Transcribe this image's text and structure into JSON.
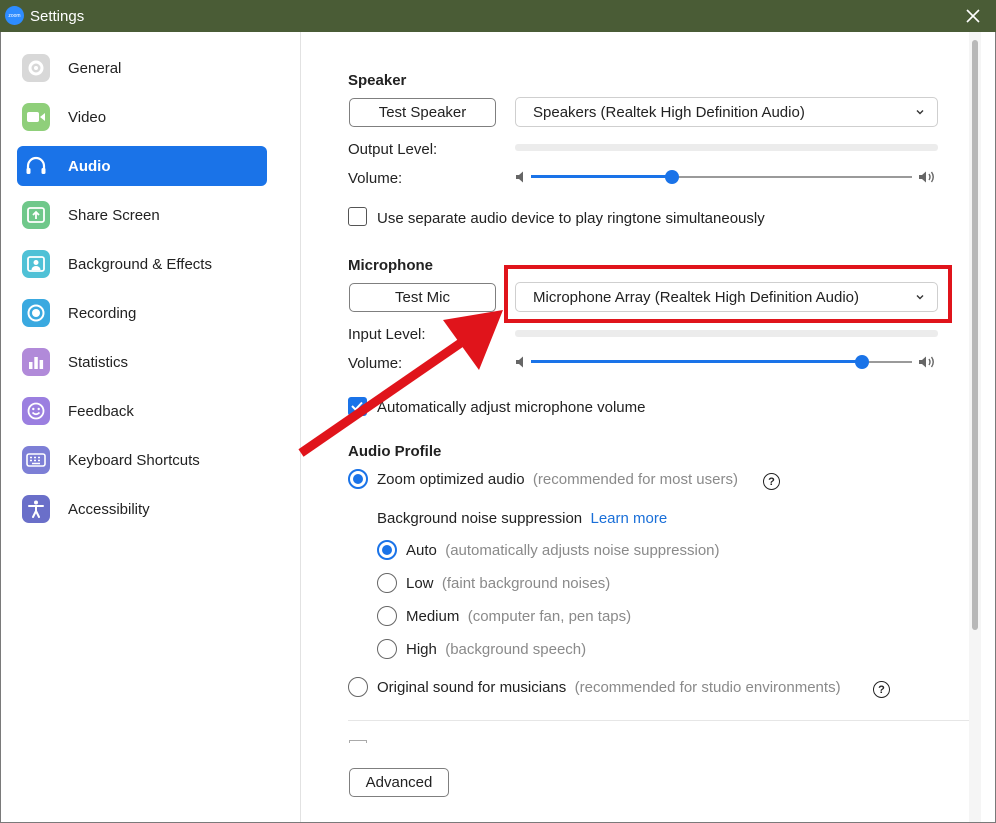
{
  "window": {
    "title": "Settings",
    "logo_text": "zoom"
  },
  "sidebar": {
    "items": [
      {
        "label": "General",
        "icon": "gear-icon",
        "color": "#cfcfcf",
        "active": false
      },
      {
        "label": "Video",
        "icon": "video-camera-icon",
        "color": "#8fcf7a",
        "active": false
      },
      {
        "label": "Audio",
        "icon": "headphones-icon",
        "color": "#1a73e8",
        "active": true
      },
      {
        "label": "Share Screen",
        "icon": "share-screen-icon",
        "color": "#6fc88a",
        "active": false
      },
      {
        "label": "Background & Effects",
        "icon": "background-person-icon",
        "color": "#4fc1d6",
        "active": false
      },
      {
        "label": "Recording",
        "icon": "recording-icon",
        "color": "#3aa9e0",
        "active": false
      },
      {
        "label": "Statistics",
        "icon": "bar-chart-icon",
        "color": "#b18ad9",
        "active": false
      },
      {
        "label": "Feedback",
        "icon": "smiley-icon",
        "color": "#9b7fe0",
        "active": false
      },
      {
        "label": "Keyboard Shortcuts",
        "icon": "keyboard-icon",
        "color": "#7d7fd6",
        "active": false
      },
      {
        "label": "Accessibility",
        "icon": "accessibility-icon",
        "color": "#6a6fc9",
        "active": false
      }
    ]
  },
  "speaker": {
    "title": "Speaker",
    "test_button": "Test Speaker",
    "device": "Speakers (Realtek High Definition Audio)",
    "output_level_label": "Output Level:",
    "volume_label": "Volume:",
    "volume_value": 0.37
  },
  "ringtone": {
    "label": "Use separate audio device to play ringtone simultaneously",
    "checked": false
  },
  "microphone": {
    "title": "Microphone",
    "test_button": "Test Mic",
    "device": "Microphone Array (Realtek High Definition Audio)",
    "input_level_label": "Input Level:",
    "volume_label": "Volume:",
    "volume_value": 0.87
  },
  "auto_adjust": {
    "label": "Automatically adjust microphone volume",
    "checked": true
  },
  "audio_profile": {
    "title": "Audio Profile",
    "zoom_optimized": {
      "label": "Zoom optimized audio",
      "hint": "(recommended for most users)",
      "checked": true
    },
    "noise_suppression": {
      "label": "Background noise suppression",
      "link": "Learn more",
      "options": [
        {
          "label": "Auto",
          "hint": "(automatically adjusts noise suppression)",
          "checked": true
        },
        {
          "label": "Low",
          "hint": "(faint background noises)",
          "checked": false
        },
        {
          "label": "Medium",
          "hint": "(computer fan, pen taps)",
          "checked": false
        },
        {
          "label": "High",
          "hint": "(background speech)",
          "checked": false
        }
      ]
    },
    "original_sound": {
      "label": "Original sound for musicians",
      "hint": "(recommended for studio environments)",
      "checked": false
    }
  },
  "advanced_button": "Advanced",
  "help_glyph": "?",
  "colors": {
    "accent": "#1a73e8",
    "titlebar": "#4a5c36",
    "annotation": "#e0141b"
  }
}
